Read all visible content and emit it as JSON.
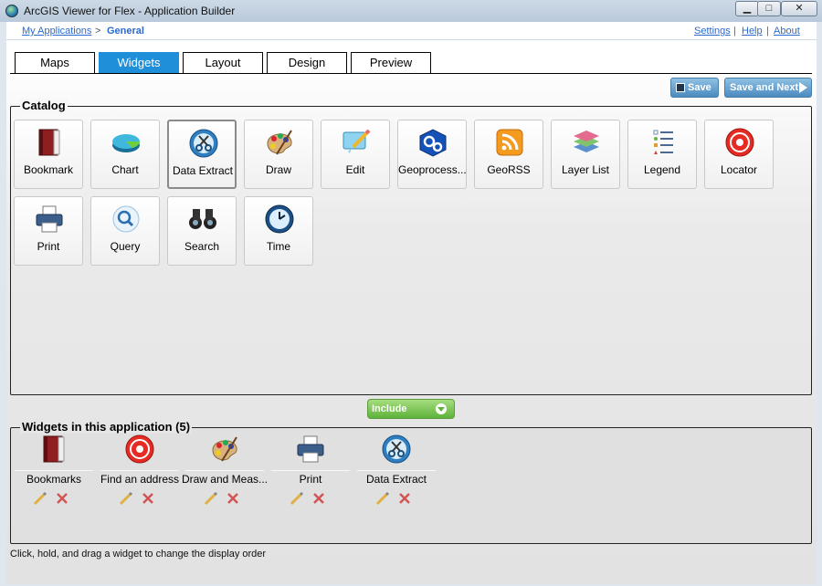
{
  "window": {
    "title": "ArcGIS Viewer for Flex - Application Builder",
    "min_glyph": "▁",
    "max_glyph": "□",
    "close_glyph": "✕"
  },
  "breadcrumb": {
    "my_applications": "My Applications",
    "separator": ">",
    "current": "General"
  },
  "toplinks": {
    "settings": "Settings",
    "separator": "|",
    "help": "Help",
    "about": "About"
  },
  "tabs": [
    {
      "label": "Maps",
      "active": false
    },
    {
      "label": "Widgets",
      "active": true
    },
    {
      "label": "Layout",
      "active": false
    },
    {
      "label": "Design",
      "active": false
    },
    {
      "label": "Preview",
      "active": false
    }
  ],
  "toolbar": {
    "save_label": "Save",
    "save_next_label": "Save and Next"
  },
  "catalog": {
    "title": "Catalog",
    "widgets": [
      {
        "label": "Bookmark",
        "icon": "book-icon"
      },
      {
        "label": "Chart",
        "icon": "pie-chart-icon"
      },
      {
        "label": "Data Extract",
        "icon": "scissors-icon",
        "selected": true
      },
      {
        "label": "Draw",
        "icon": "palette-icon"
      },
      {
        "label": "Edit",
        "icon": "pencil-note-icon"
      },
      {
        "label": "Geoprocess...",
        "icon": "gears-icon"
      },
      {
        "label": "GeoRSS",
        "icon": "rss-icon"
      },
      {
        "label": "Layer List",
        "icon": "layers-icon"
      },
      {
        "label": "Legend",
        "icon": "legend-list-icon"
      },
      {
        "label": "Locator",
        "icon": "target-icon"
      },
      {
        "label": "Print",
        "icon": "printer-icon"
      },
      {
        "label": "Query",
        "icon": "magnifier-icon"
      },
      {
        "label": "Search",
        "icon": "binoculars-icon"
      },
      {
        "label": "Time",
        "icon": "clock-icon"
      }
    ]
  },
  "include_label": "Include",
  "installed": {
    "title": "Widgets in this application (5)",
    "widgets": [
      {
        "label": "Bookmarks",
        "icon": "book-icon"
      },
      {
        "label": "Find an address",
        "icon": "target-icon"
      },
      {
        "label": "Draw and Meas...",
        "icon": "palette-icon"
      },
      {
        "label": "Print",
        "icon": "printer-icon"
      },
      {
        "label": "Data Extract",
        "icon": "scissors-icon"
      }
    ]
  },
  "hint": "Click, hold, and drag a widget to change the display order",
  "colors": {
    "active_tab": "#1e8fd8",
    "include_green": "#5eb23a",
    "link_blue": "#2a6ad0"
  }
}
